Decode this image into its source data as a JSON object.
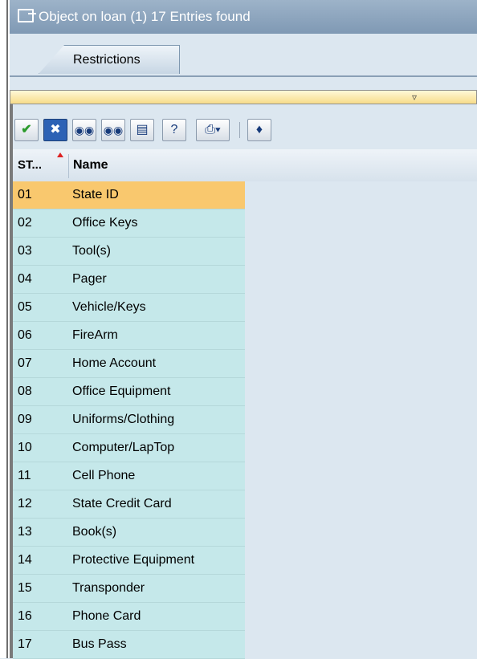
{
  "window": {
    "title": "Object on loan (1)   17 Entries found",
    "title_icon": "window-icon"
  },
  "tabs": [
    {
      "label": "Restrictions"
    }
  ],
  "filter_bar": {
    "icon": "filter-icon"
  },
  "toolbar": {
    "buttons": [
      {
        "name": "confirm-button",
        "icon": "check-icon"
      },
      {
        "name": "cancel-button",
        "icon": "cancel-icon"
      },
      {
        "name": "find-button",
        "icon": "binoculars-icon"
      },
      {
        "name": "find-next-button",
        "icon": "binoculars-next-icon"
      },
      {
        "name": "filter-values-button",
        "icon": "list-icon"
      },
      {
        "name": "help-button",
        "icon": "help-icon"
      },
      {
        "name": "print-button",
        "icon": "printer-icon"
      },
      {
        "name": "personal-list-button",
        "icon": "bookmark-icon"
      }
    ]
  },
  "table": {
    "columns": [
      "ST...",
      "Name"
    ],
    "sort_indicator": "ascending",
    "rows": [
      {
        "id": "01",
        "name": "State ID"
      },
      {
        "id": "02",
        "name": "Office Keys"
      },
      {
        "id": "03",
        "name": "Tool(s)"
      },
      {
        "id": "04",
        "name": "Pager"
      },
      {
        "id": "05",
        "name": "Vehicle/Keys"
      },
      {
        "id": "06",
        "name": "FireArm"
      },
      {
        "id": "07",
        "name": "Home Account"
      },
      {
        "id": "08",
        "name": "Office Equipment"
      },
      {
        "id": "09",
        "name": "Uniforms/Clothing"
      },
      {
        "id": "10",
        "name": "Computer/LapTop"
      },
      {
        "id": "11",
        "name": "Cell Phone"
      },
      {
        "id": "12",
        "name": "State Credit Card"
      },
      {
        "id": "13",
        "name": "Book(s)"
      },
      {
        "id": "14",
        "name": "Protective Equipment"
      },
      {
        "id": "15",
        "name": "Transponder"
      },
      {
        "id": "16",
        "name": "Phone Card"
      },
      {
        "id": "17",
        "name": "Bus Pass"
      }
    ],
    "selected_index": 0
  },
  "colors": {
    "title_bar": "#8ba4bd",
    "row_bg": "#c5e8ea",
    "selected_row": "#f9c86e",
    "filter_bar": "#f7dc8a"
  }
}
